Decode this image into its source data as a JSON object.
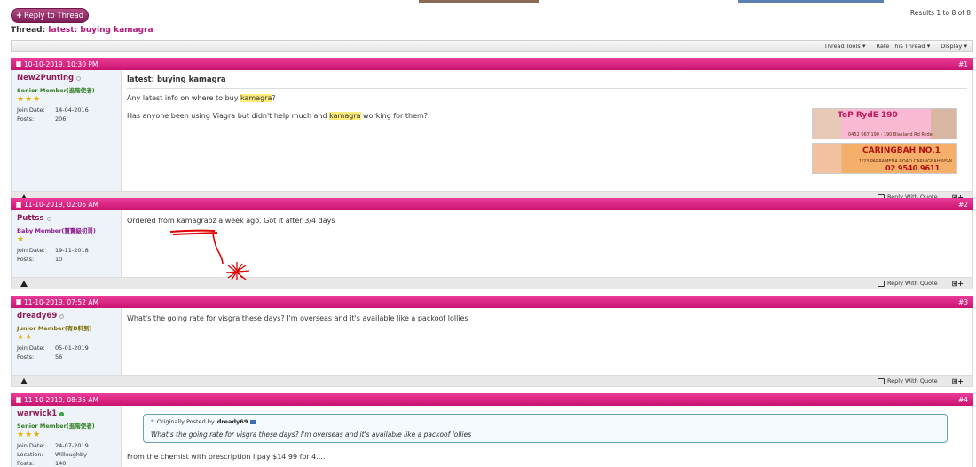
{
  "reply_to_thread": "Reply to Thread",
  "results": "Results 1 to 8 of 8",
  "thread": {
    "prefix": "Thread:",
    "title": "latest: buying kamagra"
  },
  "toolbar": {
    "thread_tools": "Thread Tools",
    "rate": "Rate This Thread",
    "display": "Display"
  },
  "posts": [
    {
      "date": "10-10-2019, 10:30 PM",
      "num": "#1",
      "username": "New2Punting",
      "usertitle": "Senior Member(進階使者)",
      "stars": 3,
      "join_label": "Join Date:",
      "join": "14-04-2016",
      "posts_label": "Posts:",
      "posts": "206",
      "title": "latest: buying kamagra",
      "line1": [
        "Any latest info on where to buy ",
        "kamagra",
        "?"
      ],
      "line2": [
        "Has anyone been using Viagra but didn't help much and ",
        "kamagra",
        " working for them?"
      ]
    },
    {
      "date": "11-10-2019, 02:06 AM",
      "num": "#2",
      "username": "Puttss",
      "usertitle": "Baby Member(寶寶級初哥)",
      "stars": 1,
      "join_label": "Join Date:",
      "join": "19-11-2018",
      "posts_label": "Posts:",
      "posts": "10",
      "text": "Ordered from kamagraoz a week ago. Got it after 3/4 days"
    },
    {
      "date": "11-10-2019, 07:52 AM",
      "num": "#3",
      "username": "dready69",
      "usertitle": "Junior Member(有D料到)",
      "stars": 2,
      "join_label": "Join Date:",
      "join": "05-01-2019",
      "posts_label": "Posts:",
      "posts": "56",
      "text": "What's the going rate for visgra these days? I'm overseas and it's available like a packoof lollies"
    },
    {
      "date": "11-10-2019, 08:35 AM",
      "num": "#4",
      "username": "warwick1",
      "usertitle": "Senior Member(進階使者)",
      "stars": 3,
      "join_label": "Join Date:",
      "join": "24-07-2019",
      "location_label": "Location:",
      "location": "Willoughby",
      "posts_label": "Posts:",
      "posts": "140",
      "quote_prefix": "Originally Posted by",
      "quote_author": "dready69",
      "quote_text": "What's the going rate for visgra these days? I'm overseas and it's available like a packoof lollies",
      "text": "From the chemist with prescription I pay $14.99 for 4...."
    }
  ],
  "reply_with_quote": "Reply With Quote",
  "ads": [
    {
      "title": "ToP RydE 190",
      "sub": "0452 667 190 · 190 Blaxland Rd Ryde"
    },
    {
      "title": "CARINGBAH NO.1",
      "sub": "1/23 PARRAMENA ROAD CARINGBAH NSW",
      "phone": "02 9540 9611"
    }
  ],
  "colors": {
    "header_pink": "#d81b7f",
    "username": "#8e1b56",
    "highlight": "#ffec7a",
    "annotation": "#e00000"
  }
}
